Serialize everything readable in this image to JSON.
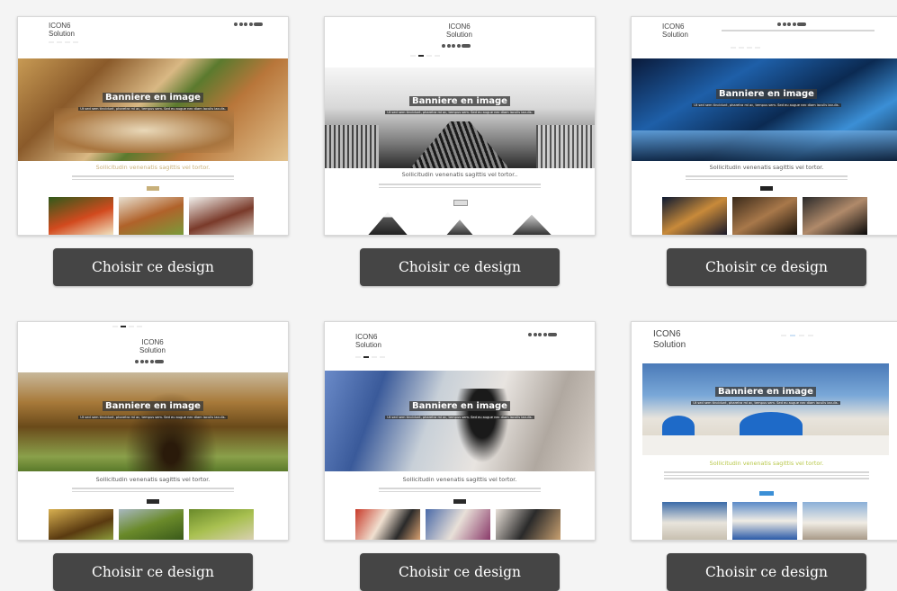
{
  "button_label": "Choisir ce design",
  "templates": [
    {
      "logo_line1": "ICON6",
      "logo_line2": "Solution",
      "hero_title": "Banniere en image",
      "hero_subtitle": "Ut sed sem tincidunt, pharetra mi ac, tempus sem. Sed eu augue nec diam iaculis iaculis.",
      "tagline": "Sollicitudin venenatis sagittis vel tortor.",
      "accent": "#c8b07a"
    },
    {
      "logo_line1": "ICON6",
      "logo_line2": "Solution",
      "hero_title": "Banniere en image",
      "hero_subtitle": "Ut sed sem tincidunt, pharetra mi ac, tempus sem. Sed eu augue nec diam iaculis iaculis.",
      "tagline": "Sollicitudin venenatis sagittis vel tortor..",
      "accent": "#8a8a8a"
    },
    {
      "logo_line1": "ICON6",
      "logo_line2": "Solution",
      "hero_title": "Banniere en image",
      "hero_subtitle": "Ut sed sem tincidunt, pharetra mi ac, tempus sem. Sed eu augue nec diam iaculis iaculis.",
      "tagline": "Sollicitudin venenatis sagittis vel tortor.",
      "accent": "#222222"
    },
    {
      "logo_line1": "ICON6",
      "logo_line2": "Solution",
      "hero_title": "Banniere en image",
      "hero_subtitle": "Ut sed sem tincidunt, pharetra mi ac, tempus sem. Sed eu augue nec diam iaculis iaculis.",
      "tagline": "Sollicitudin venenatis sagittis vel tortor.",
      "accent": "#2a2a2a"
    },
    {
      "logo_line1": "ICON6",
      "logo_line2": "Solution",
      "hero_title": "Banniere en image",
      "hero_subtitle": "Ut sed sem tincidunt, pharetra mi ac, tempus sem. Sed eu augue nec diam iaculis iaculis.",
      "tagline": "Sollicitudin venenatis sagittis vel tortor.",
      "accent": "#2a2a2a"
    },
    {
      "logo_line1": "ICON6",
      "logo_line2": "Solution",
      "hero_title": "Banniere en image",
      "hero_subtitle": "Ut sed sem tincidunt, pharetra mi ac, tempus sem. Sed eu augue nec diam iaculis iaculis.",
      "tagline": "Sollicitudin venenatis sagittis vel tortor.",
      "accent": "#3b8fd6"
    }
  ],
  "colors": {
    "page_bg": "#f4f4f4",
    "button_bg": "#454545",
    "button_text": "#ffffff"
  }
}
